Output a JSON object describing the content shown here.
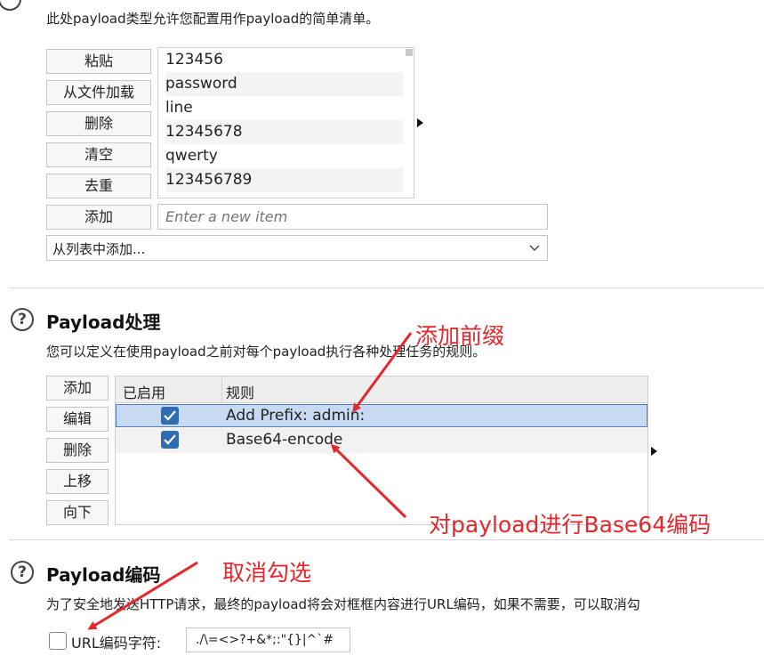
{
  "top": {
    "description": "此处payload类型允许您配置用作payload的简单清单。",
    "buttons": [
      "粘贴",
      "从文件加载",
      "删除",
      "清空",
      "去重"
    ],
    "add_button": "添加",
    "items": [
      "123456",
      "password",
      "line",
      "12345678",
      "qwerty",
      "123456789"
    ],
    "new_item_placeholder": "Enter a new item",
    "add_from_list": "从列表中添加..."
  },
  "processing": {
    "help_icon": "?",
    "title": "Payload处理",
    "description": "您可以定义在使用payload之前对每个payload执行各种处理任务的规则。",
    "buttons": [
      "添加",
      "编辑",
      "删除",
      "上移",
      "向下"
    ],
    "col_enabled": "已启用",
    "col_rule": "规则",
    "rules": [
      {
        "enabled": true,
        "rule": "Add Prefix: admin:"
      },
      {
        "enabled": true,
        "rule": "Base64-encode"
      }
    ]
  },
  "encoding": {
    "help_icon": "?",
    "title": "Payload编码",
    "description": "为了安全地发送HTTP请求，最终的payload将会对框框内容进行URL编码，如果不需要，可以取消勾",
    "checkbox_label": "URL编码字符:",
    "chars_value": "./\\=<>?+&*;:\"{}|^`#"
  },
  "annotations": {
    "add_prefix": "添加前缀",
    "base64": "对payload进行Base64编码",
    "uncheck": "取消勾选"
  },
  "colors": {
    "annotation": "#e8262b",
    "checkbox": "#2f6db0",
    "selected_row": "#c7daf2"
  }
}
